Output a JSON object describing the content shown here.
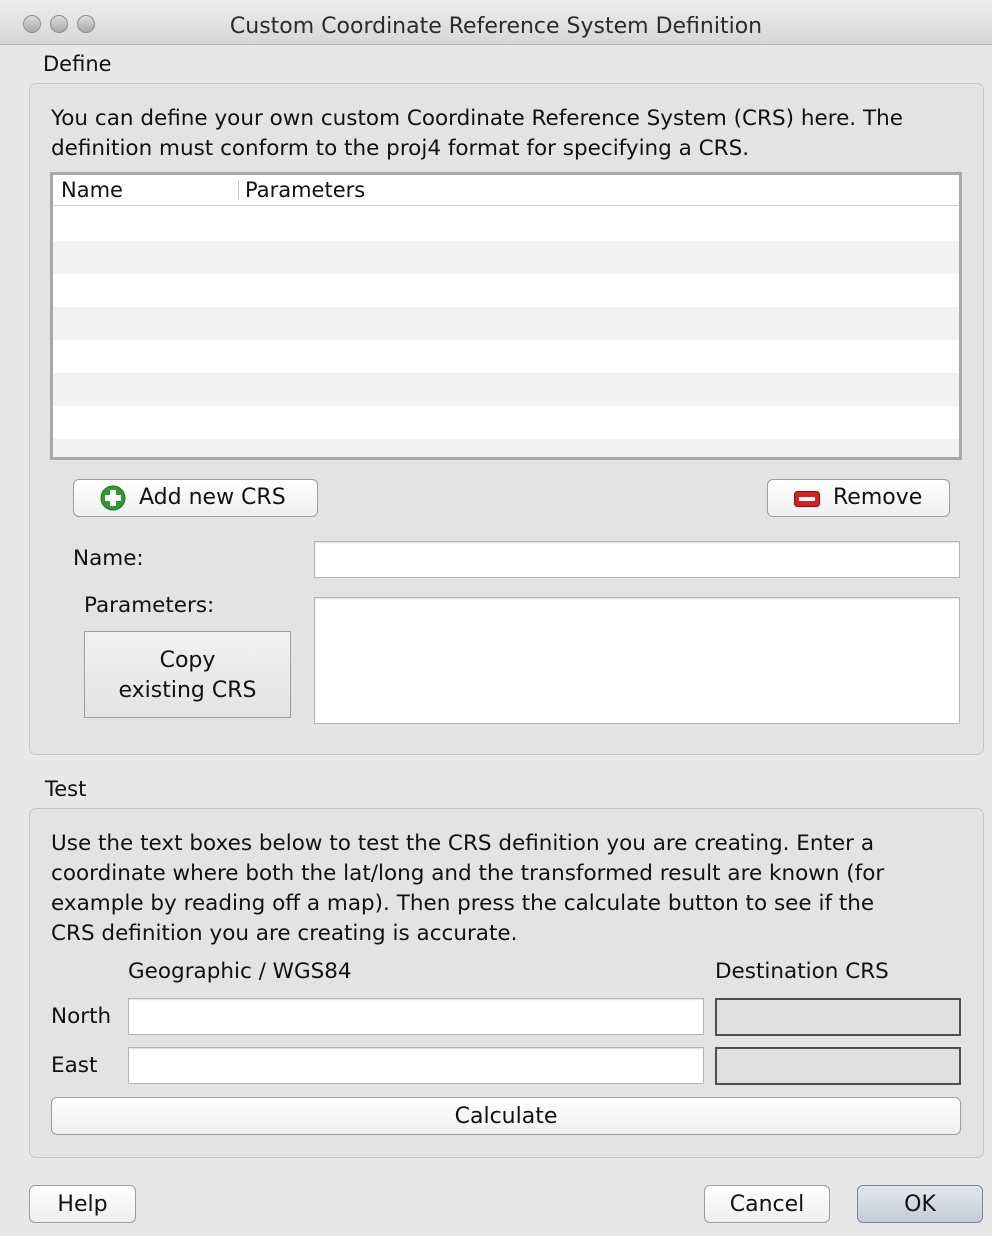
{
  "window": {
    "title": "Custom Coordinate Reference System Definition"
  },
  "define": {
    "section_label": "Define",
    "description_line1": "You can define your own custom Coordinate Reference System (CRS) here. The",
    "description_line2": "definition must conform to the proj4 format for specifying a CRS.",
    "table": {
      "columns": [
        "Name",
        "Parameters"
      ],
      "rows": []
    },
    "add_button": "Add new CRS",
    "remove_button": "Remove",
    "name_label": "Name:",
    "name_value": "",
    "parameters_label": "Parameters:",
    "parameters_value": "",
    "copy_button_line1": "Copy",
    "copy_button_line2": "existing CRS"
  },
  "test": {
    "section_label": "Test",
    "description_lines": [
      "Use the text boxes below to test the CRS definition you are creating. Enter a",
      "coordinate where both the lat/long and the transformed result are known (for",
      "example by reading off a map). Then press the calculate button to see if the",
      "CRS definition you are creating is accurate."
    ],
    "geographic_header": "Geographic / WGS84",
    "destination_header": "Destination CRS",
    "north_label": "North",
    "east_label": "East",
    "north_value": "",
    "east_value": "",
    "calculate_button": "Calculate"
  },
  "footer": {
    "help": "Help",
    "cancel": "Cancel",
    "ok": "OK"
  },
  "icons": {
    "add": "plus-icon",
    "remove": "minus-icon"
  },
  "colors": {
    "add_icon": "#3aa83a",
    "remove_icon": "#d42020",
    "ok_button": "#cbd3de"
  }
}
